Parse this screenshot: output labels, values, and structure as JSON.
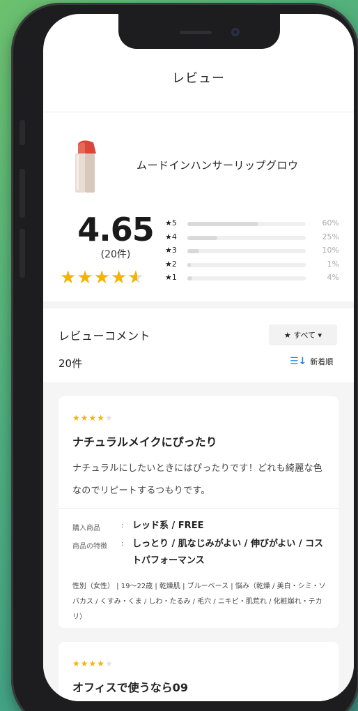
{
  "header": {
    "title": "レビュー"
  },
  "product": {
    "name": "ムードインハンサーリップグロウ"
  },
  "rating": {
    "score": "4.65",
    "count": "(20件)",
    "stars": 4.65,
    "distribution": [
      {
        "label": "★5",
        "percent": 60,
        "percent_label": "60%"
      },
      {
        "label": "★4",
        "percent": 25,
        "percent_label": "25%"
      },
      {
        "label": "★3",
        "percent": 10,
        "percent_label": "10%"
      },
      {
        "label": "★2",
        "percent": 1,
        "percent_label": "1%"
      },
      {
        "label": "★1",
        "percent": 4,
        "percent_label": "4%"
      }
    ]
  },
  "comments": {
    "title": "レビューコメント",
    "filter_label": "★ すべて ▾",
    "total": "20件",
    "sort_label": "新着順"
  },
  "reviews": [
    {
      "stars": 4,
      "title": "ナチュラルメイクにぴったり",
      "body": "ナチュラルにしたいときにはぴったりです！どれも綺麗な色なのでリピートするつもりです。",
      "purchase_label": "購入商品",
      "purchase_value": "レッド系 / FREE",
      "features_label": "商品の特徴",
      "features_value": "しっとり / 肌なじみがよい / 伸びがよい / コストパフォーマンス",
      "profile": "性別（女性） | 19〜22歳 | 乾燥肌 | ブルーベース | 悩み（乾燥 / 美白・シミ・ソバカス / くすみ・くま / しわ・たるみ / 毛穴 / ニキビ・肌荒れ / 化粧崩れ・テカリ）"
    },
    {
      "stars": 4,
      "title": "オフィスで使うなら09"
    }
  ],
  "colors": {
    "star": "#f5b400",
    "accent": "#1e88e5",
    "background": "#4fae7f"
  }
}
